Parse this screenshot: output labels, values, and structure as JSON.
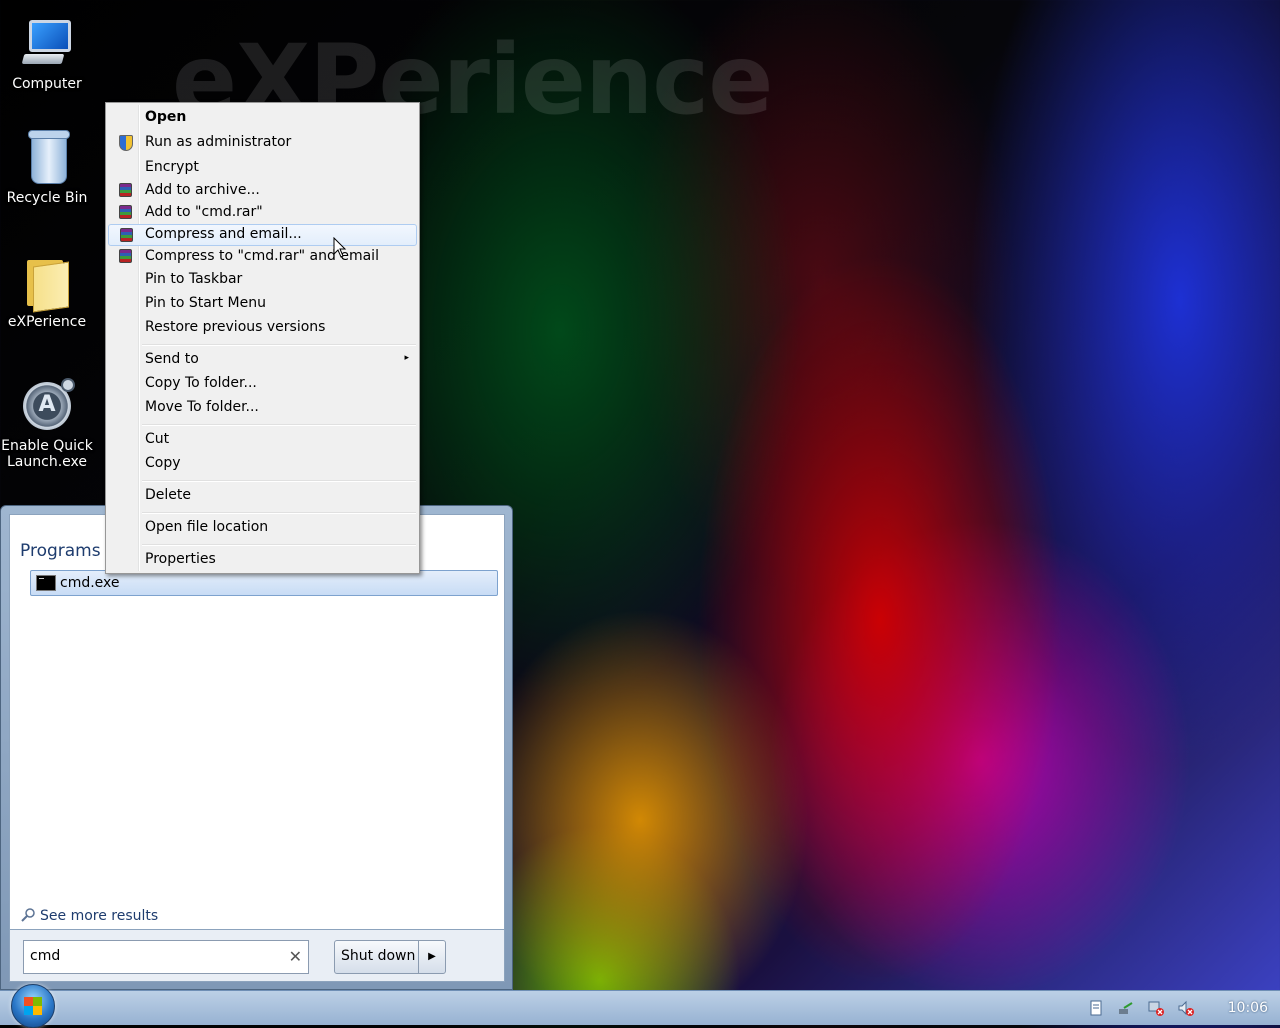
{
  "watermark": "eXPerience",
  "desktop": {
    "icons": [
      {
        "label": "Computer",
        "icon": "computer-icon"
      },
      {
        "label": "Recycle Bin",
        "icon": "recycle-bin-icon"
      },
      {
        "label": "eXPerience",
        "icon": "folder-icon"
      },
      {
        "label": "Enable Quick Launch.exe",
        "icon": "quick-launch-icon"
      }
    ]
  },
  "start_menu": {
    "section_title": "Programs (",
    "results": [
      {
        "label": "cmd.exe",
        "icon": "console-icon"
      }
    ],
    "see_more": "See more results",
    "search": {
      "value": "cmd",
      "clear_glyph": "✕"
    },
    "shutdown": {
      "label": "Shut down",
      "arrow": "▶"
    }
  },
  "context_menu": {
    "items": [
      {
        "label": "Open",
        "bold": true
      },
      {
        "label": "Run as administrator",
        "icon": "uac-shield-icon"
      },
      {
        "label": "Encrypt"
      },
      {
        "label": "Add to archive...",
        "icon": "winrar-icon"
      },
      {
        "label": "Add to \"cmd.rar\"",
        "icon": "winrar-icon"
      },
      {
        "label": "Compress and email...",
        "icon": "winrar-icon",
        "highlighted": true
      },
      {
        "label": "Compress to \"cmd.rar\" and email",
        "icon": "winrar-icon"
      },
      {
        "label": "Pin to Taskbar"
      },
      {
        "label": "Pin to Start Menu"
      },
      {
        "label": "Restore previous versions"
      },
      {
        "label": "Send to",
        "submenu": true
      },
      {
        "label": "Copy To folder..."
      },
      {
        "label": "Move To folder..."
      },
      {
        "label": "Cut"
      },
      {
        "label": "Copy"
      },
      {
        "label": "Delete"
      },
      {
        "label": "Open file location"
      },
      {
        "label": "Properties"
      }
    ],
    "submenu_arrow": "▸"
  },
  "taskbar": {
    "tray_icons": [
      "action-center-icon",
      "network-icon",
      "network-disconnected-icon",
      "volume-muted-icon"
    ],
    "clock": "10:06"
  },
  "colors": {
    "menu_background": "#f0f0f0",
    "highlight_border": "#aeccf1",
    "start_menu_title": "#1e3c6e"
  }
}
